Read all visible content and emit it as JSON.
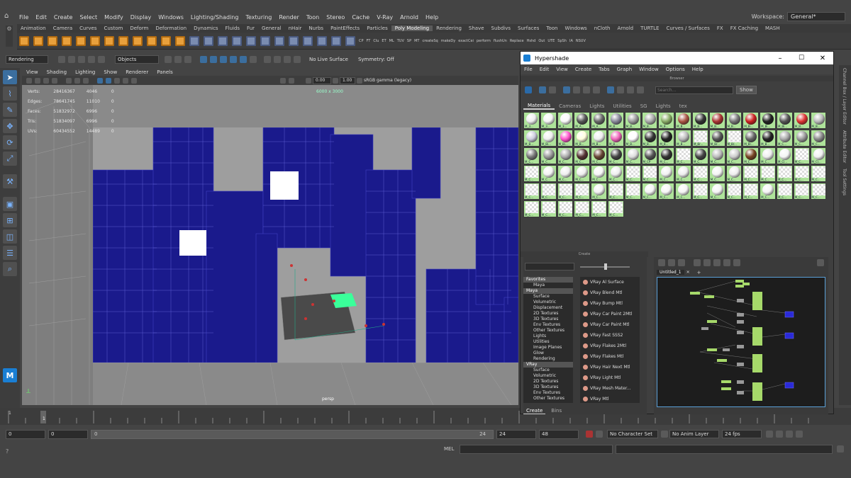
{
  "menubar": [
    "File",
    "Edit",
    "Create",
    "Select",
    "Modify",
    "Display",
    "Windows",
    "Lighting/Shading",
    "Texturing",
    "Render",
    "Toon",
    "Stereo",
    "Cache",
    "V-Ray",
    "Arnold",
    "Help"
  ],
  "workspace": {
    "label": "Workspace:",
    "value": "General*"
  },
  "shelf_tabs": [
    "Animation",
    "Camera",
    "Curves",
    "Custom",
    "Deform",
    "Deformation",
    "Dynamics",
    "Fluids",
    "Fur",
    "General",
    "nHair",
    "Nurbs",
    "PaintEffects",
    "Particles",
    "Poly Modeling",
    "Rendering",
    "Shave",
    "Subdivs",
    "Surfaces",
    "Toon",
    "Windows",
    "nCloth",
    "Arnold",
    "TURTLE",
    "Curves / Surfaces",
    "FX",
    "FX Caching",
    "MASH"
  ],
  "shelf_active": "Poly Modeling",
  "shelf_labels": [
    "CP",
    "FT",
    "Clu",
    "ET",
    "ML",
    "TUV",
    "SP",
    "MT",
    "createSq",
    "makeDy",
    "exactCei",
    "perform",
    "flushUn",
    "Replace",
    "Hshd",
    "Out",
    "UTE",
    "SpSh",
    "IA",
    "NSUV"
  ],
  "status": {
    "mode": "Rendering",
    "objects": "Objects",
    "live": "No Live Surface",
    "symmetry": "Symmetry: Off"
  },
  "viewport": {
    "menus": [
      "View",
      "Shading",
      "Lighting",
      "Show",
      "Renderer",
      "Panels"
    ],
    "exposure": "0.00",
    "gamma": "1.00",
    "colorspace": "sRGB gamma (legacy)",
    "resgate": "6000 x 3000",
    "camera": "persp",
    "hud": [
      {
        "label": "Verts:",
        "a": "28416367",
        "b": "4046",
        "c": "0"
      },
      {
        "label": "Edges:",
        "a": "78641745",
        "b": "11010",
        "c": "0"
      },
      {
        "label": "Faces:",
        "a": "51832972",
        "b": "6996",
        "c": "0"
      },
      {
        "label": "Tris:",
        "a": "51834097",
        "b": "6996",
        "c": "0"
      },
      {
        "label": "UVs:",
        "a": "60434552",
        "b": "14489",
        "c": "0"
      }
    ]
  },
  "timeline": {
    "ticks": [
      "1"
    ],
    "current": "1"
  },
  "range": {
    "start": "0",
    "min": "0",
    "slider_start": "0",
    "slider_end": "24",
    "end": "24",
    "max": "48",
    "character": "No Character Set",
    "anim_layer": "No Anim Layer",
    "fps": "24 fps"
  },
  "cmd": {
    "lang": "MEL"
  },
  "right_tabs": [
    "Channel Box / Layer Editor",
    "Attribute Editor",
    "Tool Settings"
  ],
  "hypershade": {
    "title": "Hypershade",
    "menus": [
      "File",
      "Edit",
      "View",
      "Create",
      "Tabs",
      "Graph",
      "Window",
      "Options",
      "Help"
    ],
    "browser_label": "Browser",
    "search_placeholder": "Search...",
    "show_button": "Show",
    "tabs": [
      "Materials",
      "Cameras",
      "Lights",
      "Utilities",
      "SG",
      "Lights",
      "tex"
    ],
    "create_label": "Create",
    "tree": [
      {
        "t": "Favorites",
        "hdr": true
      },
      {
        "t": "Maya",
        "hdr": false
      },
      {
        "t": "Maya",
        "hdr": true
      },
      {
        "t": "Surface",
        "hdr": false
      },
      {
        "t": "Volumetric",
        "hdr": false
      },
      {
        "t": "Displacement",
        "hdr": false
      },
      {
        "t": "2D Textures",
        "hdr": false
      },
      {
        "t": "3D Textures",
        "hdr": false
      },
      {
        "t": "Env Textures",
        "hdr": false
      },
      {
        "t": "Other Textures",
        "hdr": false
      },
      {
        "t": "Lights",
        "hdr": false
      },
      {
        "t": "Utilities",
        "hdr": false
      },
      {
        "t": "Image Planes",
        "hdr": false
      },
      {
        "t": "Glow",
        "hdr": false
      },
      {
        "t": "Rendering",
        "hdr": false
      },
      {
        "t": "VRay",
        "hdr": true
      },
      {
        "t": "Surface",
        "hdr": false
      },
      {
        "t": "Volumetric",
        "hdr": false
      },
      {
        "t": "2D Textures",
        "hdr": false
      },
      {
        "t": "3D Textures",
        "hdr": false
      },
      {
        "t": "Env Textures",
        "hdr": false
      },
      {
        "t": "Other Textures",
        "hdr": false
      }
    ],
    "nodes": [
      "VRay Al Surface",
      "VRay Blend Mtl",
      "VRay Bump Mtl",
      "VRay Car Paint 2Mtl",
      "VRay Car Paint Mtl",
      "VRay Fast SSS2",
      "VRay Flakes 2Mtl",
      "VRay Flakes Mtl",
      "VRay Hair Next Mtl",
      "VRay Light Mtl",
      "VRay Mesh Mater...",
      "VRay Mtl"
    ],
    "bottom_tabs": [
      "Create",
      "Bins"
    ],
    "graph_tab": "Untitled_1",
    "graph_add": "+",
    "materials": [
      {
        "l": "M_3...",
        "c": "#eee",
        "k": 0
      },
      {
        "l": "M_3...",
        "c": "#f4f4f4",
        "k": 0
      },
      {
        "l": "M_3...",
        "c": "#fafafa",
        "k": 0
      },
      {
        "l": "M_A...",
        "c": "#555",
        "k": 0
      },
      {
        "l": "M_A...",
        "c": "#666",
        "k": 0
      },
      {
        "l": "M_B...",
        "c": "#889",
        "k": 0
      },
      {
        "l": "M_B...",
        "c": "#999",
        "k": 0
      },
      {
        "l": "M_B...",
        "c": "#aaa",
        "k": 0
      },
      {
        "l": "M_B...",
        "c": "#8a6",
        "k": 0
      },
      {
        "l": "M_B...",
        "c": "#a54",
        "k": 0
      },
      {
        "l": "M_B...",
        "c": "#333",
        "k": 0
      },
      {
        "l": "M_B...",
        "c": "#a33",
        "k": 0
      },
      {
        "l": "M_B...",
        "c": "#777",
        "k": 0
      },
      {
        "l": "M_Bi...",
        "c": "#c22",
        "k": 0
      },
      {
        "l": "M_Bi...",
        "c": "#222",
        "k": 0
      },
      {
        "l": "M_Bi...",
        "c": "#555",
        "k": 0
      },
      {
        "l": "M_B...",
        "c": "#d33",
        "k": 0
      },
      {
        "l": "M_B...",
        "c": "#bbb",
        "k": 0
      },
      {
        "l": "M_B...",
        "c": "#ccd",
        "k": 0
      },
      {
        "l": "M_Bi...",
        "c": "#eee",
        "k": 0
      },
      {
        "l": "M_Bi...",
        "c": "#f5c",
        "k": 0
      },
      {
        "l": "M_B...",
        "c": "#ffd",
        "k": 0
      },
      {
        "l": "M_B...",
        "c": "#eee",
        "k": 0
      },
      {
        "l": "M_B...",
        "c": "#e6b",
        "k": 0
      },
      {
        "l": "M_B...",
        "c": "#fff",
        "k": 0
      },
      {
        "l": "M_B...",
        "c": "#333",
        "k": 0
      },
      {
        "l": "M_B...",
        "c": "#222",
        "k": 0
      },
      {
        "l": "M_B...",
        "c": "#bbb",
        "k": 0
      },
      {
        "l": "M_Br...",
        "c": "#f6e",
        "k": 1
      },
      {
        "l": "M_Br...",
        "c": "#555",
        "k": 0
      },
      {
        "l": "M_Br...",
        "c": "#ddd",
        "k": 1
      },
      {
        "l": "M_Br...",
        "c": "#666",
        "k": 0
      },
      {
        "l": "M_B...",
        "c": "#222",
        "k": 0
      },
      {
        "l": "M_C...",
        "c": "#aaa",
        "k": 0
      },
      {
        "l": "M_C...",
        "c": "#999",
        "k": 0
      },
      {
        "l": "M_C...",
        "c": "#888",
        "k": 0
      },
      {
        "l": "M_C...",
        "c": "#777",
        "k": 0
      },
      {
        "l": "M_C...",
        "c": "#999",
        "k": 0
      },
      {
        "l": "M_C...",
        "c": "#aaa",
        "k": 0
      },
      {
        "l": "M_C...",
        "c": "#533",
        "k": 0
      },
      {
        "l": "M_C...",
        "c": "#643",
        "k": 0
      },
      {
        "l": "M_C...",
        "c": "#444",
        "k": 0
      },
      {
        "l": "M_C...",
        "c": "#ddd",
        "k": 0
      },
      {
        "l": "M_CP",
        "c": "#555",
        "k": 0
      },
      {
        "l": "M_C...",
        "c": "#333",
        "k": 0
      },
      {
        "l": "M_C...",
        "c": "#eee",
        "k": 1
      },
      {
        "l": "M_C...",
        "c": "#444",
        "k": 0
      },
      {
        "l": "M_C...",
        "c": "#bbb",
        "k": 0
      },
      {
        "l": "M_C...",
        "c": "#ccc",
        "k": 0
      },
      {
        "l": "M_C...",
        "c": "#742",
        "k": 0
      },
      {
        "l": "M_C...",
        "c": "#eee",
        "k": 0
      },
      {
        "l": "M_Cl...",
        "c": "#f4f4f4",
        "k": 0
      },
      {
        "l": "M_C...",
        "c": "#eee",
        "k": 1
      },
      {
        "l": "M_Cl...",
        "c": "#f0f0f0",
        "k": 0
      },
      {
        "l": "M_C...",
        "c": "#eee",
        "k": 1
      },
      {
        "l": "M_C...",
        "c": "#f2f2f2",
        "k": 0
      },
      {
        "l": "M_C...",
        "c": "#eee",
        "k": 0
      },
      {
        "l": "M_C...",
        "c": "#eee",
        "k": 0
      },
      {
        "l": "M_C...",
        "c": "#f6f6f6",
        "k": 0
      },
      {
        "l": "M_C...",
        "c": "#eee",
        "k": 0
      },
      {
        "l": "M_C...",
        "c": "#eee",
        "k": 1
      },
      {
        "l": "M_C...",
        "c": "#eee",
        "k": 1
      },
      {
        "l": "M_C...",
        "c": "#f1f1f1",
        "k": 0
      },
      {
        "l": "M_C...",
        "c": "#eee",
        "k": 0
      },
      {
        "l": "M_C...",
        "c": "#eee",
        "k": 1
      },
      {
        "l": "M_C...",
        "c": "#f4f4f4",
        "k": 0
      },
      {
        "l": "M_C...",
        "c": "#eee",
        "k": 0
      },
      {
        "l": "M_C...",
        "c": "#eee",
        "k": 1
      },
      {
        "l": "M_C...",
        "c": "#eee",
        "k": 1
      },
      {
        "l": "M_C...",
        "c": "#eee",
        "k": 1
      },
      {
        "l": "M_C...",
        "c": "#eee",
        "k": 1
      },
      {
        "l": "M_C...",
        "c": "#eee",
        "k": 1
      },
      {
        "l": "M_C...",
        "c": "#eee",
        "k": 1
      },
      {
        "l": "M_C...",
        "c": "#eee",
        "k": 1
      },
      {
        "l": "M_C...",
        "c": "#eee",
        "k": 1
      },
      {
        "l": "M_C...",
        "c": "#eee",
        "k": 1
      },
      {
        "l": "M_C...",
        "c": "#f2f2f2",
        "k": 0
      },
      {
        "l": "M_C...",
        "c": "#eee",
        "k": 1
      },
      {
        "l": "M_C...",
        "c": "#eee",
        "k": 1
      },
      {
        "l": "M_C...",
        "c": "#f4f4f4",
        "k": 0
      },
      {
        "l": "M_C...",
        "c": "#f6f6f6",
        "k": 0
      },
      {
        "l": "M_C...",
        "c": "#f4f4f4",
        "k": 0
      },
      {
        "l": "M_C...",
        "c": "#eee",
        "k": 1
      },
      {
        "l": "M_C...",
        "c": "#f4f4f4",
        "k": 0
      },
      {
        "l": "M_C...",
        "c": "#eee",
        "k": 1
      },
      {
        "l": "M_C...",
        "c": "#eee",
        "k": 1
      },
      {
        "l": "M_C...",
        "c": "#f4f4f4",
        "k": 0
      },
      {
        "l": "M_C...",
        "c": "#eee",
        "k": 1
      },
      {
        "l": "M_C...",
        "c": "#eee",
        "k": 1
      },
      {
        "l": "M_C...",
        "c": "#eee",
        "k": 1
      },
      {
        "l": "M_C...",
        "c": "#eee",
        "k": 1
      },
      {
        "l": "M_C...",
        "c": "#eee",
        "k": 1
      },
      {
        "l": "M_C...",
        "c": "#eee",
        "k": 1
      },
      {
        "l": "M_C...",
        "c": "#eee",
        "k": 1
      },
      {
        "l": "M_C...",
        "c": "#eee",
        "k": 1
      },
      {
        "l": "M_C...",
        "c": "#eee",
        "k": 1
      }
    ]
  },
  "colors": {
    "accent": "#5aa0d8",
    "wire": "#1a1a8c",
    "swatch_bg": "#aee39a"
  }
}
